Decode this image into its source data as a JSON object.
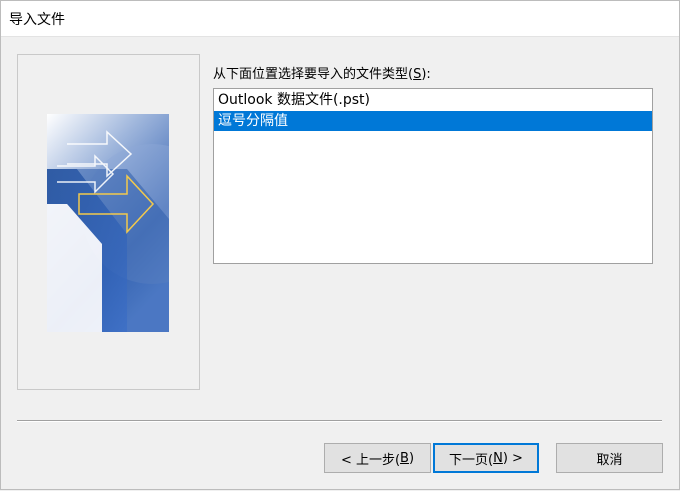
{
  "window": {
    "title": "导入文件"
  },
  "prompt": {
    "text_before": "从下面位置选择要导入的文件类型(",
    "mnemonic": "S",
    "text_after": "):"
  },
  "list": {
    "items": [
      {
        "label": "Outlook 数据文件(.pst)",
        "selected": false
      },
      {
        "label": "逗号分隔值",
        "selected": true
      }
    ]
  },
  "buttons": {
    "back": {
      "before": "< 上一步(",
      "mnemonic": "B",
      "after": ")"
    },
    "next": {
      "before": "下一页(",
      "mnemonic": "N",
      "after": ") >"
    },
    "cancel": {
      "label": "取消"
    }
  },
  "colors": {
    "selection": "#0078d7",
    "dialog_bg": "#f0f0f0",
    "graphic_blue": "#2f5aa8"
  }
}
